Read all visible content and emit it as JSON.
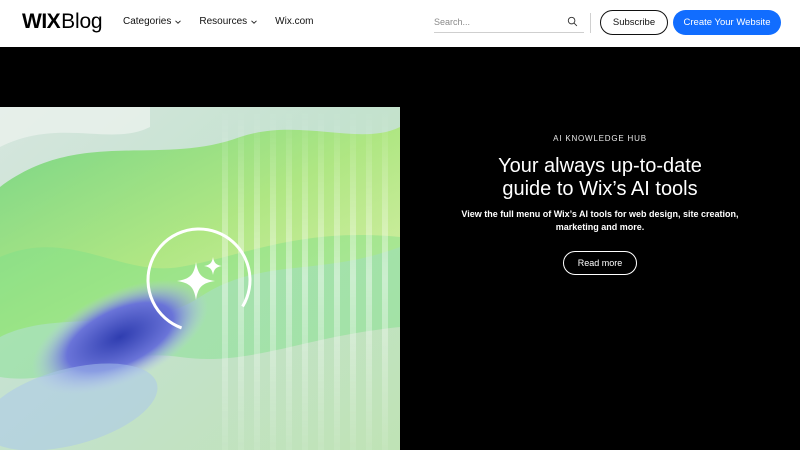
{
  "header": {
    "logo_wix": "WIX",
    "logo_blog": "Blog",
    "nav": [
      {
        "label": "Categories",
        "has_dropdown": true
      },
      {
        "label": "Resources",
        "has_dropdown": true
      },
      {
        "label": "Wix.com",
        "has_dropdown": false
      }
    ],
    "search": {
      "placeholder": "Search..."
    },
    "subscribe_label": "Subscribe",
    "create_label": "Create Your Website"
  },
  "hero": {
    "eyebrow": "AI KNOWLEDGE HUB",
    "title_line1": "Your always up-to-date",
    "title_line2": "guide to Wix’s AI tools",
    "description": "View the full menu of Wix’s AI tools for web design, site creation, marketing and more.",
    "read_more_label": "Read more"
  },
  "colors": {
    "accent": "#116dff",
    "hero_background": "#000000",
    "header_background": "#ffffff"
  }
}
